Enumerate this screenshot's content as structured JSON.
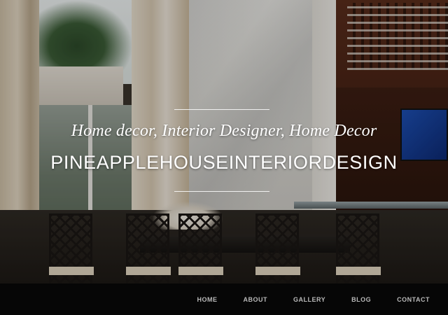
{
  "hero": {
    "tagline": "Home decor, Interior Designer, Home Decor",
    "site_title": "PINEAPPLEHOUSEINTERIORDESIGN"
  },
  "nav": {
    "items": [
      {
        "label": "HOME"
      },
      {
        "label": "ABOUT"
      },
      {
        "label": "GALLERY"
      },
      {
        "label": "BLOG"
      },
      {
        "label": "CONTACT"
      }
    ]
  },
  "colors": {
    "navbar_bg": "#060606",
    "nav_text": "#b9b9b9",
    "hero_text": "#ffffff"
  }
}
